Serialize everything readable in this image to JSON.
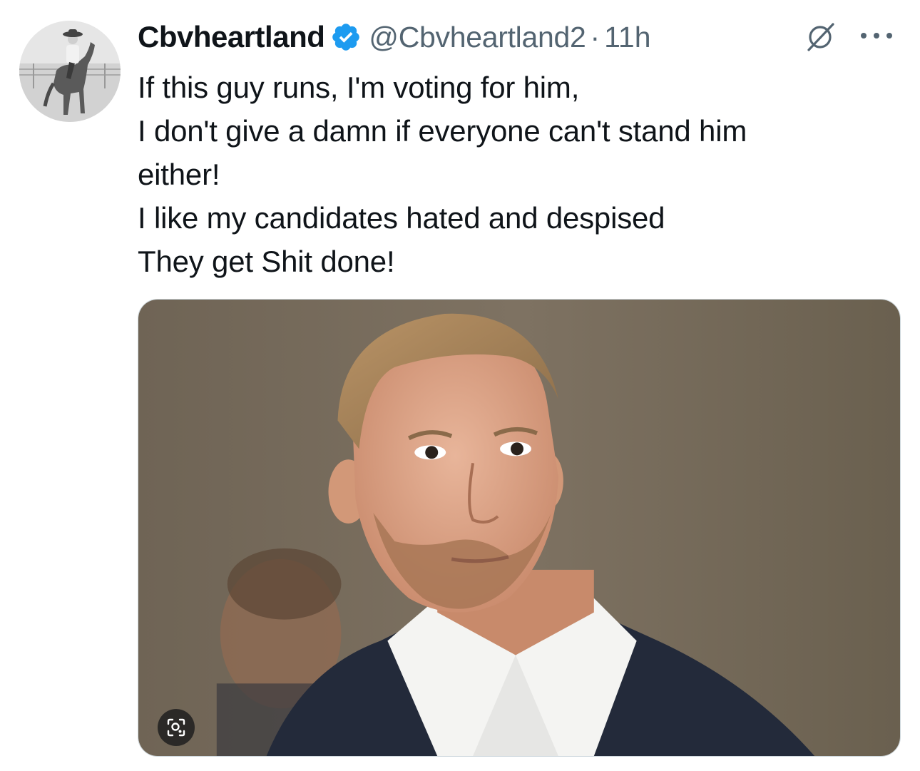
{
  "tweet": {
    "display_name": "Cbvheartland",
    "verified": true,
    "handle": "@Cbvheartland2",
    "separator": "·",
    "time": "11h",
    "lines": [
      "If this guy runs, I'm voting for him,",
      "I don't give a damn if everyone can't stand him",
      "either!",
      "I like my candidates hated and despised",
      "They get Shit done!"
    ]
  },
  "icons": {
    "verified": "verified-badge-icon",
    "grok": "grok-icon",
    "more": "more-options-icon",
    "lens": "visual-search-icon"
  },
  "colors": {
    "verified_blue": "#1d9bf0",
    "secondary_text": "#536471",
    "primary_text": "#0f1419"
  }
}
